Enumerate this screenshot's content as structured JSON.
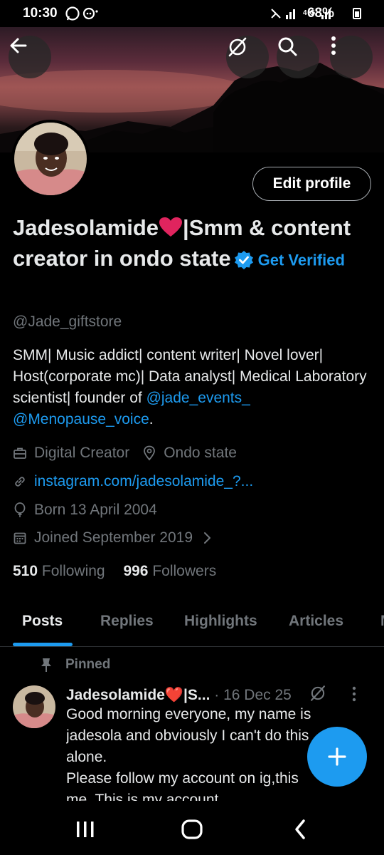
{
  "status_bar": {
    "time": "10:30",
    "battery_percent": "68%",
    "network": "4G"
  },
  "header": {
    "back_icon": "arrow-left-icon",
    "grok_icon": "slash-circle-icon",
    "search_icon": "search-icon",
    "more_icon": "vertical-dots-icon"
  },
  "profile": {
    "edit_label": "Edit profile",
    "name_part1": "Jadesolamide",
    "name_part2": "|Smm & content creator in ondo state",
    "get_verified": "Get Verified",
    "handle": "@Jade_giftstore",
    "bio_text": "SMM| Music addict| content writer| Novel lover| Host(corporate mc)|  Data analyst| Medical Laboratory scientist| founder of ",
    "bio_mention1": "@jade_events_",
    "bio_mention2": "@Menopause_voice",
    "bio_end": ".",
    "category": "Digital Creator",
    "location": "Ondo state",
    "website": "instagram.com/jadesolamide_?...",
    "birthday": "Born 13 April 2004",
    "joined": "Joined September 2019",
    "following_count": "510",
    "following_label": "Following",
    "followers_count": "996",
    "followers_label": "Followers"
  },
  "tabs": [
    {
      "label": "Posts",
      "active": true
    },
    {
      "label": "Replies",
      "active": false
    },
    {
      "label": "Highlights",
      "active": false
    },
    {
      "label": "Articles",
      "active": false
    }
  ],
  "pinned_post": {
    "pinned_label": "Pinned",
    "author": "Jadesolamide❤️|S...",
    "date": "· 16 Dec 25",
    "text_line1": "Good morning everyone, my name is",
    "text_line2": "jadesola and obviously I can't do this",
    "text_line3": "alone.",
    "text_line4": "Please follow my account on ig,this",
    "text_line5": "me. This is my account"
  },
  "colors": {
    "accent": "#1d9bf0",
    "secondary_text": "#71767b",
    "heart": "#e0245e"
  }
}
